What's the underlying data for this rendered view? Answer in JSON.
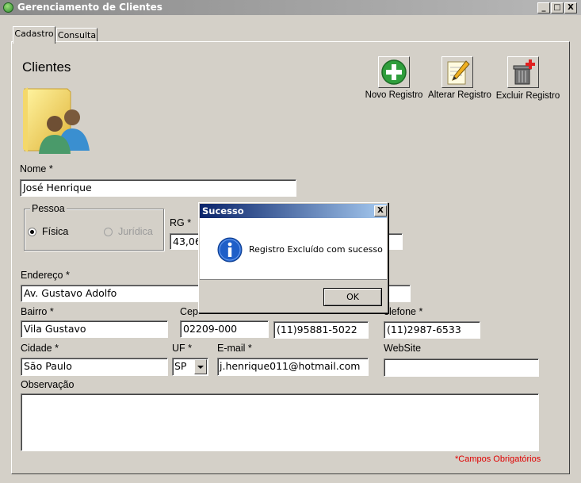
{
  "window": {
    "title": "Gerenciamento de Clientes",
    "minimize": "_",
    "maximize": "□",
    "close": "X"
  },
  "tabs": [
    {
      "label": "Cadastro"
    },
    {
      "label": "Consulta"
    }
  ],
  "page": {
    "heading": "Clientes"
  },
  "toolbar": {
    "novo": "Novo Registro",
    "alterar": "Alterar Registro",
    "excluir": "Excluir Registro"
  },
  "form": {
    "nome_label": "Nome *",
    "nome_value": "José Henrique",
    "pessoa_label": "Pessoa",
    "fisica_label": "Física",
    "juridica_label": "Jurídica",
    "pessoa_selected": "Física",
    "rg_label": "RG *",
    "rg_value": "43,06",
    "endereco_label": "Endereço *",
    "endereco_value": "Av. Gustavo Adolfo",
    "bairro_label": "Bairro *",
    "bairro_value": "Vila Gustavo",
    "cep_label": "Cep",
    "cep_value": "02209-000",
    "celular_value": "(11)95881-5022",
    "telefone_label": "elefone *",
    "telefone_value": "(11)2987-6533",
    "cidade_label": "Cidade *",
    "cidade_value": "São Paulo",
    "uf_label": "UF *",
    "uf_value": "SP",
    "email_label": "E-mail *",
    "email_value": "j.henrique011@hotmail.com",
    "website_label": "WebSite",
    "website_value": "",
    "observacao_label": "Observação",
    "observacao_value": "",
    "required_note": "*Campos Obrigatórios"
  },
  "dialog": {
    "title": "Sucesso",
    "close": "X",
    "message": "Registro Excluído com sucesso",
    "ok_label": "OK"
  },
  "colors": {
    "background": "#d4d0c8",
    "required_note": "#e00000",
    "dialog_title": "#0a246a",
    "info_icon": "#1f5fc8"
  }
}
